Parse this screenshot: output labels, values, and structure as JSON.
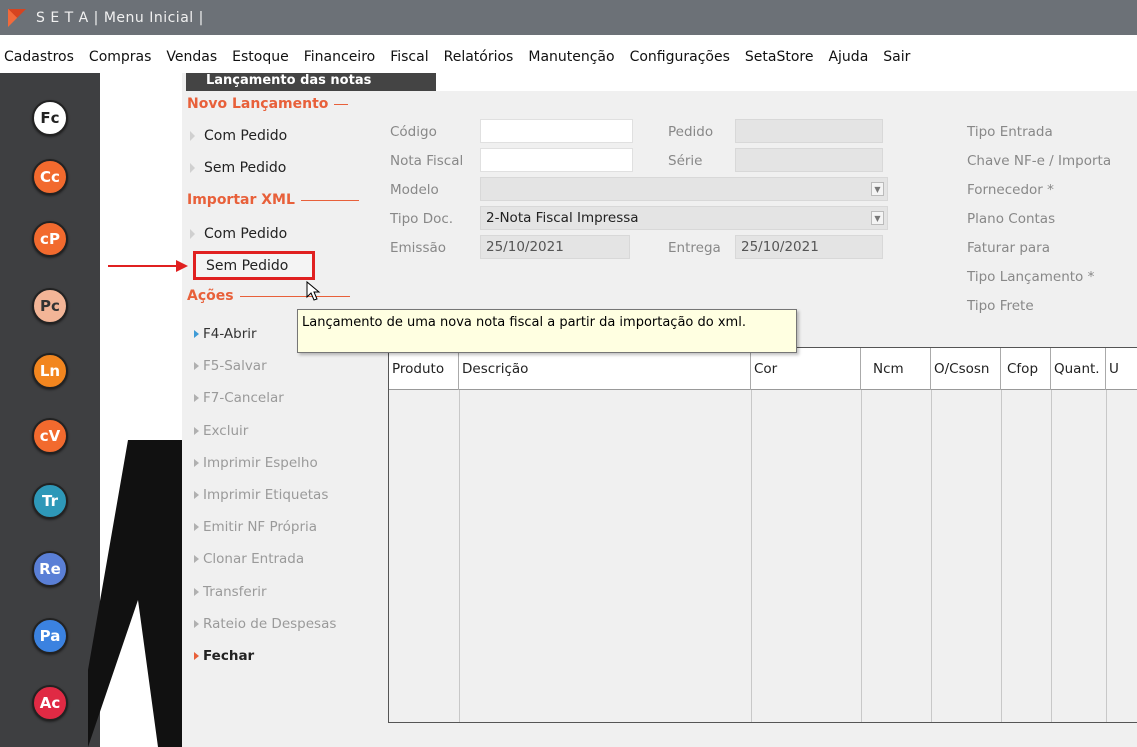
{
  "window": {
    "title": "S E T A | Menu Inicial |"
  },
  "menu": [
    "Cadastros",
    "Compras",
    "Vendas",
    "Estoque",
    "Financeiro",
    "Fiscal",
    "Relatórios",
    "Manutenção",
    "Configurações",
    "SetaStore",
    "Ajuda",
    "Sair"
  ],
  "dock": [
    {
      "label": "Fc",
      "color": "#ffffff",
      "text": "#222222"
    },
    {
      "label": "Cc",
      "color": "#f26a2e",
      "text": "#ffffff"
    },
    {
      "label": "cP",
      "color": "#f26a2e",
      "text": "#ffffff"
    },
    {
      "label": "Pc",
      "color": "#f3b597",
      "text": "#333333"
    },
    {
      "label": "Ln",
      "color": "#f2861f",
      "text": "#ffffff"
    },
    {
      "label": "cV",
      "color": "#f26a2e",
      "text": "#ffffff"
    },
    {
      "label": "Tr",
      "color": "#2e98b8",
      "text": "#ffffff"
    },
    {
      "label": "Re",
      "color": "#5a7fd6",
      "text": "#ffffff"
    },
    {
      "label": "Pa",
      "color": "#3b82e0",
      "text": "#ffffff"
    },
    {
      "label": "Ac",
      "color": "#e02a44",
      "text": "#ffffff"
    }
  ],
  "panel": {
    "header": "Lançamento das notas",
    "novo_lancamento": "Novo Lançamento",
    "novo_items": [
      "Com Pedido",
      "Sem Pedido"
    ],
    "importar_xml": "Importar XML",
    "importar_items": [
      "Com Pedido",
      "Sem Pedido"
    ],
    "acoes": "Ações",
    "actions": [
      "F4-Abrir",
      "F5-Salvar",
      "F7-Cancelar",
      "Excluir",
      "Imprimir Espelho",
      "Imprimir Etiquetas",
      "Emitir NF Própria",
      "Clonar Entrada",
      "Transferir",
      "Rateio de Despesas",
      "Fechar"
    ]
  },
  "form": {
    "codigo_label": "Código",
    "codigo_value": "",
    "pedido_label": "Pedido",
    "pedido_value": "",
    "nota_fiscal_label": "Nota Fiscal",
    "nota_fiscal_value": "",
    "serie_label": "Série",
    "serie_value": "",
    "modelo_label": "Modelo",
    "modelo_value": "",
    "tipo_doc_label": "Tipo Doc.",
    "tipo_doc_value": "2-Nota Fiscal Impressa",
    "emissao_label": "Emissão",
    "emissao_value": "25/10/2021",
    "entrega_label": "Entrega",
    "entrega_value": "25/10/2021",
    "right_labels": [
      "Tipo Entrada",
      "Chave NF-e / Importa",
      "Fornecedor *",
      "Plano Contas",
      "Faturar para",
      "Tipo Lançamento *",
      "Tipo Frete"
    ]
  },
  "grid": {
    "columns": [
      "Produto",
      "Descrição",
      "Cor",
      "Ncm",
      "O/Csosn",
      "Cfop",
      "Quant.",
      "U"
    ]
  },
  "tooltip": "Lançamento de uma nova nota fiscal a partir da importação do xml."
}
